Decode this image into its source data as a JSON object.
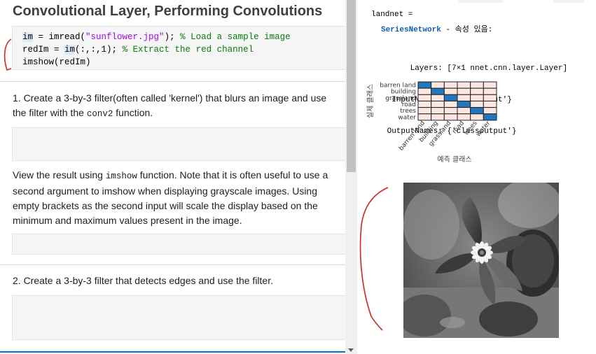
{
  "left": {
    "title": "Convolutional Layer, Performing Convolutions",
    "code_lines": [
      [
        {
          "t": "im",
          "c": "c-var"
        },
        {
          "t": " = imread("
        },
        {
          "t": "\"sunflower.jpg\"",
          "c": "c-str"
        },
        {
          "t": "); "
        },
        {
          "t": "% Load a sample image",
          "c": "c-com"
        }
      ],
      [
        {
          "t": "redIm = "
        },
        {
          "t": "im",
          "c": "c-var"
        },
        {
          "t": "(:,:,1); "
        },
        {
          "t": "% Extract the red channel",
          "c": "c-com"
        }
      ],
      [
        {
          "t": "imshow(redIm)"
        }
      ]
    ],
    "task1_before": "1. Create a 3-by-3 filter(often called 'kernel') that blurs an image and use the filter with the ",
    "task1_code": "conv2",
    "task1_after": " function.",
    "view_before": "View the result using ",
    "view_code": "imshow",
    "view_after": " function. Note that it is often useful to use a second argument to imshow when displaying grayscale images. Using empty brackets as the second input will scale the display based on the minimum and maximum values present in the image.",
    "task2": "2. Create a 3-by-3 filter that detects edges and use the filter."
  },
  "right": {
    "var_line": "landnet =",
    "series_link": "SeriesNetwork",
    "series_suffix": " - 속성 있음:",
    "prop_lines": [
      "      Layers: [7×1 nnet.cnn.layer.Layer]",
      "  InputNames: {'imageinput'}",
      " OutputNames: {'classoutput'}"
    ]
  },
  "chart_data": {
    "type": "heatmap",
    "rows": [
      "barren land",
      "building",
      "grassland",
      "road",
      "trees",
      "water"
    ],
    "columns": [
      "barren land",
      "building",
      "grassland",
      "road",
      "trees",
      "water"
    ],
    "values": [
      [
        1,
        0,
        0,
        0,
        0,
        0
      ],
      [
        0,
        1,
        0,
        0,
        0,
        0
      ],
      [
        0,
        0,
        1,
        0,
        0,
        0
      ],
      [
        0,
        0,
        0,
        1,
        0,
        0
      ],
      [
        0,
        0,
        0,
        0,
        1,
        0
      ],
      [
        0,
        0,
        0,
        0,
        0,
        1
      ]
    ],
    "title": "",
    "xlabel": "예측 클래스",
    "ylabel": "실제 클래스",
    "colors": {
      "high": "#1f77c0",
      "low": "#fbe6e0"
    }
  }
}
